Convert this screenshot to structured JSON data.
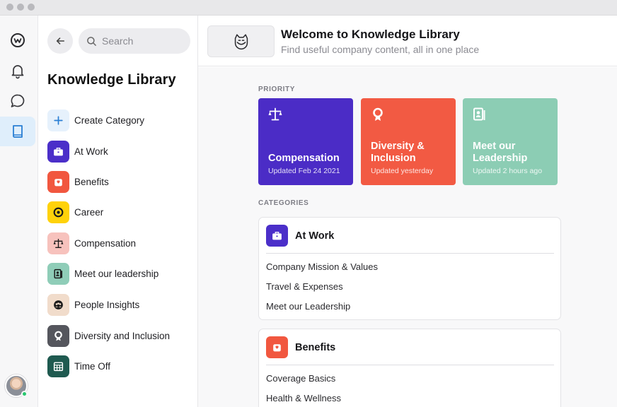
{
  "sidebar": {
    "search_placeholder": "Search",
    "title": "Knowledge Library",
    "create_label": "Create Category",
    "items": [
      {
        "label": "At Work",
        "icon": "briefcase-icon",
        "bg": "#4b2fc9"
      },
      {
        "label": "Benefits",
        "icon": "gift-icon",
        "bg": "#f1573f"
      },
      {
        "label": "Career",
        "icon": "target-icon",
        "bg": "#ffd20a"
      },
      {
        "label": "Compensation",
        "icon": "scale-icon",
        "bg": "#f7c2bd"
      },
      {
        "label": "Meet our leadership",
        "icon": "id-card-icon",
        "bg": "#8fcdb8"
      },
      {
        "label": "People Insights",
        "icon": "people-icon",
        "bg": "#f1dccb"
      },
      {
        "label": "Diversity and Inclusion",
        "icon": "ribbon-icon",
        "bg": "#55565d"
      },
      {
        "label": "Time Off",
        "icon": "calendar-icon",
        "bg": "#1f5a50"
      }
    ]
  },
  "header": {
    "title": "Welcome to Knowledge Library",
    "subtitle": "Find useful company content, all in one place"
  },
  "priority": {
    "label": "PRIORITY",
    "cards": [
      {
        "title": "Compensation",
        "updated": "Updated Feb 24 2021",
        "icon": "scale-icon",
        "color": "#4b2cc6"
      },
      {
        "title": "Diversity & Inclusion",
        "updated": "Updated yesterday",
        "icon": "ribbon-icon",
        "color": "#f25a43"
      },
      {
        "title": "Meet our Leadership",
        "updated": "Updated 2 hours ago",
        "icon": "id-card-icon",
        "color": "#8ccdb4"
      }
    ]
  },
  "categories": {
    "label": "CATEGORIES",
    "cards": [
      {
        "title": "At Work",
        "icon": "briefcase-icon",
        "color": "#4b2fc9",
        "links": [
          "Company Mission & Values",
          "Travel & Expenses",
          "Meet our Leadership"
        ]
      },
      {
        "title": "Benefits",
        "icon": "gift-icon",
        "color": "#f1573f",
        "links": [
          "Coverage Basics",
          "Health & Wellness"
        ]
      }
    ]
  }
}
